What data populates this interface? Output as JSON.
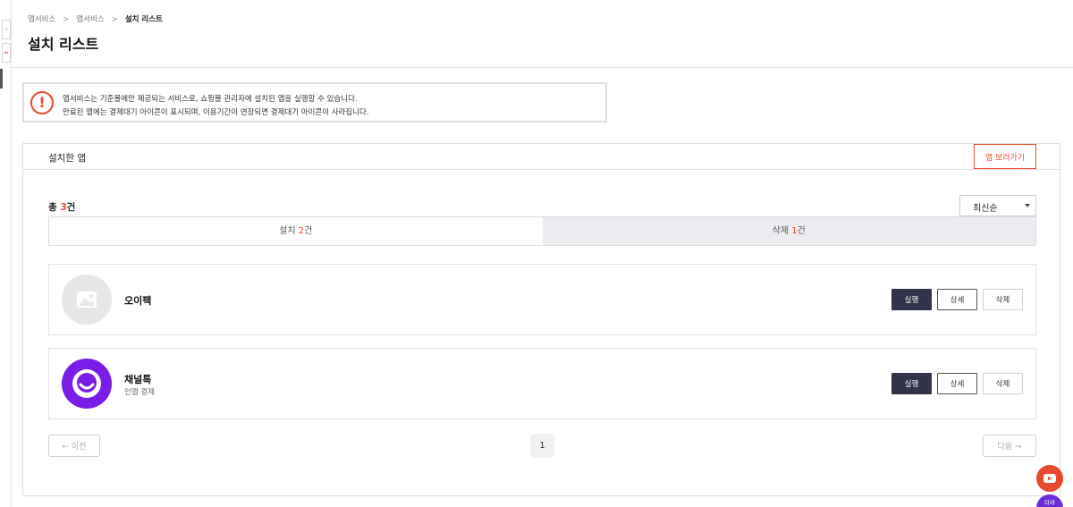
{
  "side_rail": {
    "btn_top": "‹",
    "btn_bottom": "≈"
  },
  "breadcrumb": {
    "items": [
      "앱서비스",
      "앱서비스",
      "설치 리스트"
    ],
    "separator": ">"
  },
  "page": {
    "title": "설치 리스트"
  },
  "notice": {
    "icon": "!",
    "line1": "앱서비스는 기준몰에만 제공되는 서비스로, 쇼핑몰 관리자에 설치된 앱을 실행할 수 있습니다.",
    "line2": "만료된 앱에는 결제대기 아이콘이 표시되며, 이용기간이 연장되면 결제대기 아이콘이 사라집니다."
  },
  "panel": {
    "title": "설치한 앱",
    "view_apps_label": "앱 보러가기"
  },
  "summary": {
    "total_prefix": "총 ",
    "total_count": "3",
    "total_suffix": "건"
  },
  "sort": {
    "selected": "최신순"
  },
  "tabs": [
    {
      "label": "설치 ",
      "count": "2",
      "suffix": "건"
    },
    {
      "label": "삭제 ",
      "count": "1",
      "suffix": "건"
    }
  ],
  "apps": [
    {
      "name": "오이팩",
      "subtitle": "",
      "run_label": "실행",
      "detail_label": "상세",
      "delete_label": "삭제"
    },
    {
      "name": "채널톡",
      "subtitle": "인앱 결제",
      "run_label": "실행",
      "detail_label": "상세",
      "delete_label": "삭제"
    }
  ],
  "pagination": {
    "prev_label": "이전",
    "next_label": "다음",
    "current_page": "1"
  },
  "floating": {
    "follow_label": "따라"
  },
  "colors": {
    "accent": "#e8482e",
    "run_button": "#30334a",
    "channel_logo": "#7a1de8"
  }
}
